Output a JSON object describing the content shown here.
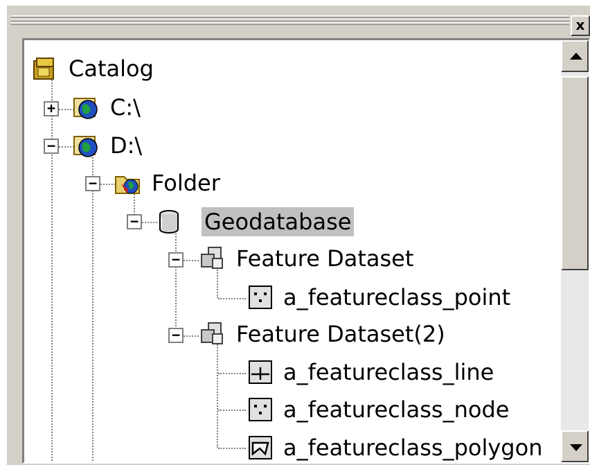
{
  "window": {
    "close_label": "x"
  },
  "tree": {
    "nodes": [
      {
        "label": "Catalog",
        "icon": "catalog-icon",
        "expander": ""
      },
      {
        "label": "C:\\",
        "icon": "drive-icon",
        "expander": "+"
      },
      {
        "label": "D:\\",
        "icon": "drive-icon",
        "expander": "−"
      },
      {
        "label": "Folder",
        "icon": "folder-icon",
        "expander": "−"
      },
      {
        "label": "Geodatabase",
        "icon": "geodatabase-icon",
        "expander": "−",
        "selected": true
      },
      {
        "label": "Feature Dataset",
        "icon": "feature-dataset-icon",
        "expander": "−"
      },
      {
        "label": "a_featureclass_point",
        "icon": "point-featureclass-icon",
        "expander": ""
      },
      {
        "label": "Feature Dataset(2)",
        "icon": "feature-dataset-icon",
        "expander": "−"
      },
      {
        "label": "a_featureclass_line",
        "icon": "line-featureclass-icon",
        "expander": ""
      },
      {
        "label": "a_featureclass_node",
        "icon": "point-featureclass-icon",
        "expander": ""
      },
      {
        "label": "a_featureclass_polygon",
        "icon": "polygon-featureclass-icon",
        "expander": ""
      }
    ]
  },
  "colors": {
    "window_bg": "#d4d0c8",
    "selection_bg": "#c0c0c0",
    "tree_bg": "#ffffff"
  }
}
